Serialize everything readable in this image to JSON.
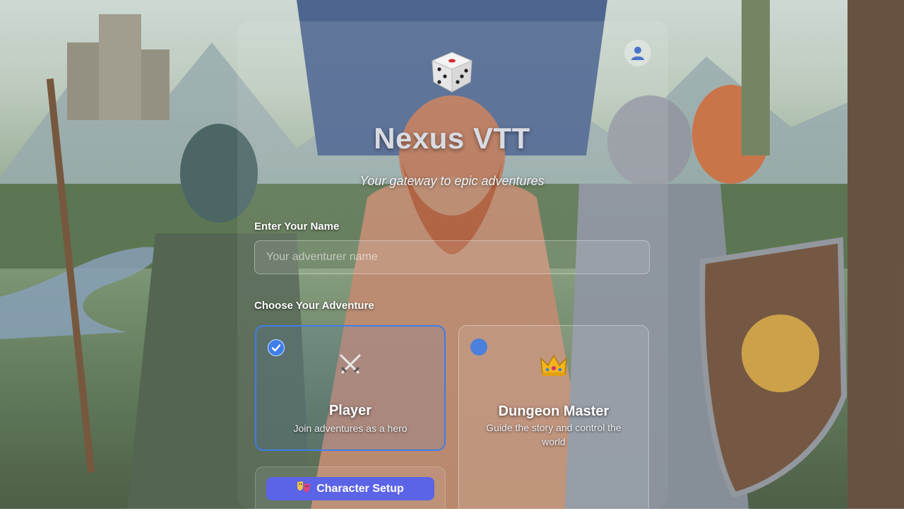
{
  "app": {
    "title": "Nexus VTT",
    "subtitle": "Your gateway to epic adventures"
  },
  "name_field": {
    "label": "Enter Your Name",
    "placeholder": "Your adventurer name",
    "value": ""
  },
  "adventure": {
    "label": "Choose Your Adventure",
    "roles": [
      {
        "title": "Player",
        "description": "Join adventures as a hero",
        "icon": "crossed-swords-icon",
        "selected": true
      },
      {
        "title": "Dungeon Master",
        "description": "Guide the story and control the world",
        "icon": "crown-icon",
        "selected": false
      }
    ]
  },
  "actions": {
    "character_setup": "Character Setup"
  },
  "colors": {
    "accent": "#3f7de8",
    "button": "#5b63e6"
  }
}
